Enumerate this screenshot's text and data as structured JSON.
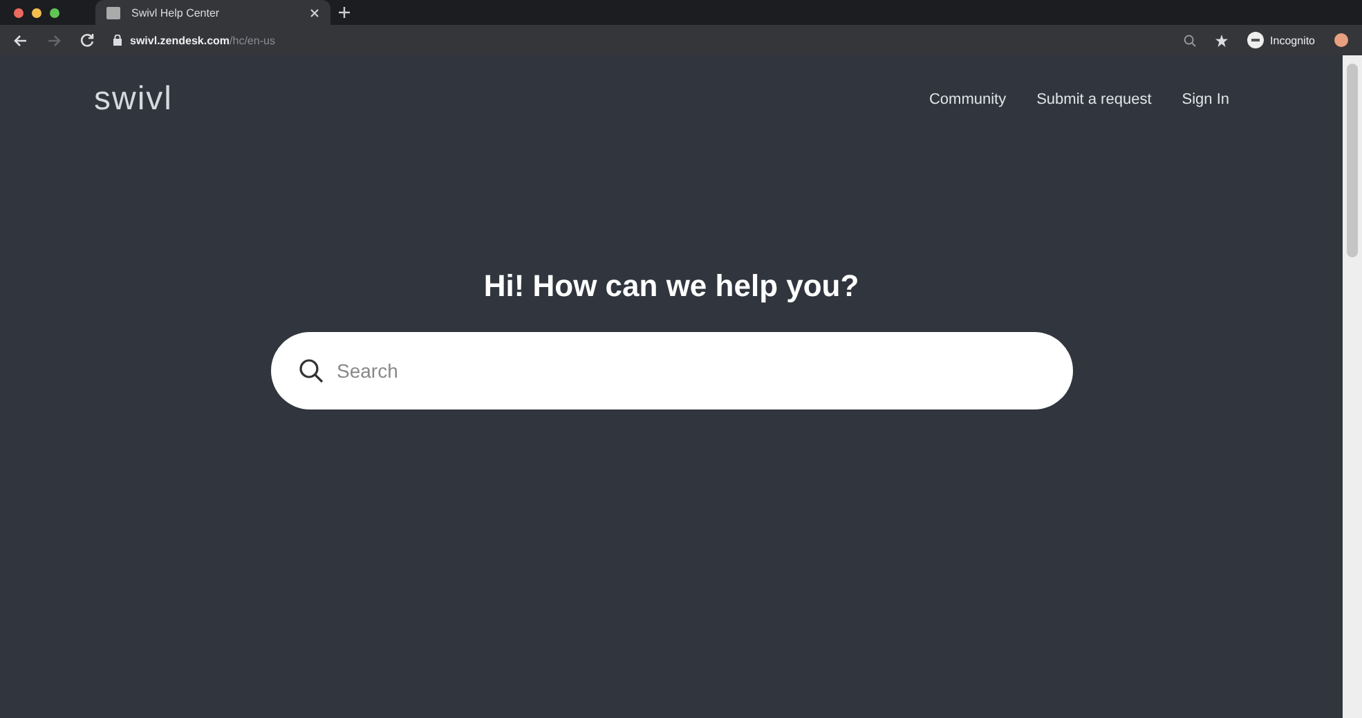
{
  "browser": {
    "tab": {
      "title": "Swivl Help Center",
      "selected": true
    },
    "url": {
      "host": "swivl.zendesk.com",
      "path": "/hc/en-us"
    },
    "profile": "Incognito"
  },
  "header": {
    "logo": "swivl",
    "nav": [
      "Community",
      "Submit a request",
      "Sign In"
    ]
  },
  "hero": {
    "heading": "Hi! How can we help you?",
    "search": {
      "placeholder": "Search"
    }
  }
}
